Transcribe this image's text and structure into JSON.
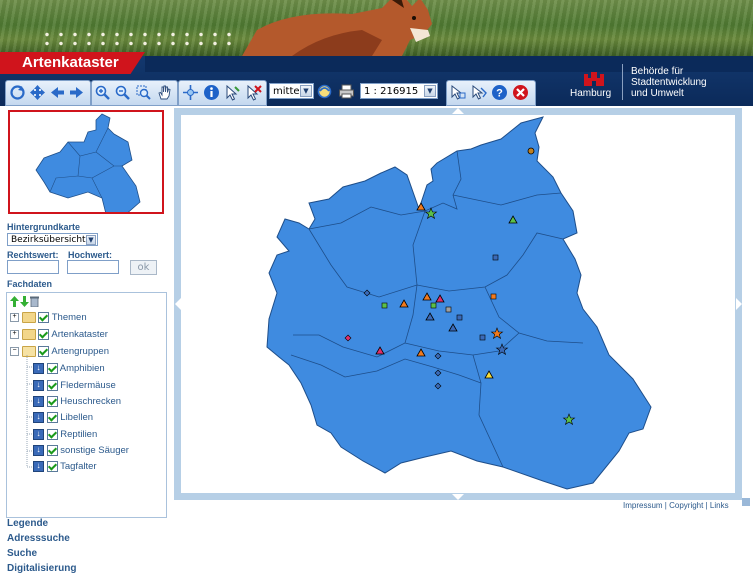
{
  "app": {
    "title": "Artenkataster"
  },
  "authority": {
    "city": "Hamburg",
    "line1": "Behörde für",
    "line2": "Stadtentwicklung",
    "line3": "und Umwelt"
  },
  "toolbar": {
    "quality_value": "mittel",
    "scale_value": "1 : 216915",
    "icons": [
      "refresh-icon",
      "pan-icon",
      "back-icon",
      "forward-icon",
      "zoom-in-icon",
      "zoom-out-icon",
      "zoom-box-icon",
      "hand-icon",
      "full-extent-icon",
      "info-icon",
      "select-icon",
      "clear-selection-icon",
      "reload-icon",
      "print-icon",
      "select-arrow-icon",
      "measure-icon",
      "help-icon",
      "close-icon"
    ]
  },
  "left": {
    "background_label": "Hintergrundkarte",
    "background_value": "Bezirksübersicht",
    "rechtswert_label": "Rechtswert:",
    "hochwert_label": "Hochwert:",
    "ok_label": "ok",
    "fachdaten_label": "Fachdaten",
    "tree": {
      "folders": [
        "Themen",
        "Artenkataster",
        "Artengruppen"
      ],
      "species": [
        "Amphibien",
        "Fledermäuse",
        "Heuschrecken",
        "Libellen",
        "Reptilien",
        "sonstige Säuger",
        "Tagfalter"
      ]
    },
    "bottom": [
      "Legende",
      "Adresssuche",
      "Suche",
      "Digitalisierung"
    ]
  },
  "footer": {
    "impressum": "Impressum",
    "copyright": "Copyright",
    "links": "Links",
    "sep": "|"
  },
  "colors": {
    "brand_red": "#d0141c",
    "nav_blue": "#0b2a5a",
    "map_blue": "#3f8be0",
    "frame_blue": "#b6cfe6"
  }
}
